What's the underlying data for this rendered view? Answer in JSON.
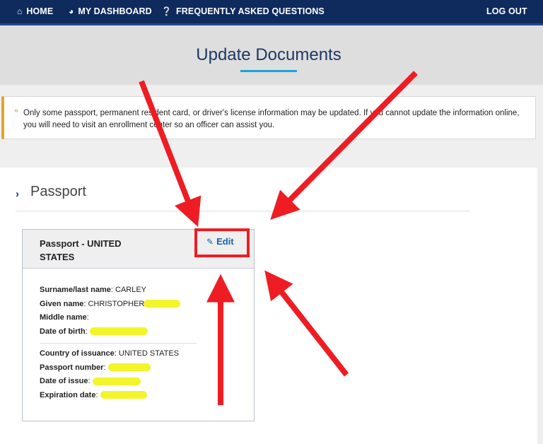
{
  "nav": {
    "home": "HOME",
    "dashboard": "MY DASHBOARD",
    "faq": "FREQUENTLY ASKED QUESTIONS",
    "logout": "LOG OUT"
  },
  "page": {
    "title": "Update Documents"
  },
  "alert": {
    "icon": "lightbulb-icon",
    "text": "Only some passport, permanent resident card, or driver's license information may be updated. If you cannot update the information online, you will need to visit an enrollment center so an officer can assist you."
  },
  "section": {
    "title": "Passport"
  },
  "card": {
    "title": "Passport - UNITED STATES",
    "edit_label": "Edit",
    "fields_personal": [
      {
        "label": "Surname/last name",
        "value": "CARLEY"
      },
      {
        "label": "Given name",
        "value": "CHRISTOPHER"
      },
      {
        "label": "Middle name",
        "value": ""
      },
      {
        "label": "Date of birth",
        "value": ""
      }
    ],
    "fields_document": [
      {
        "label": "Country of issuance",
        "value": "UNITED STATES"
      },
      {
        "label": "Passport number",
        "value": ""
      },
      {
        "label": "Date of issue",
        "value": ""
      },
      {
        "label": "Expiration date",
        "value": ""
      }
    ]
  },
  "colors": {
    "nav_bg": "#0f2a5c",
    "accent": "#1aa3d9",
    "alert_border": "#e0a72a",
    "annotation_red": "#ee1d23",
    "highlight": "#f4f42a"
  }
}
